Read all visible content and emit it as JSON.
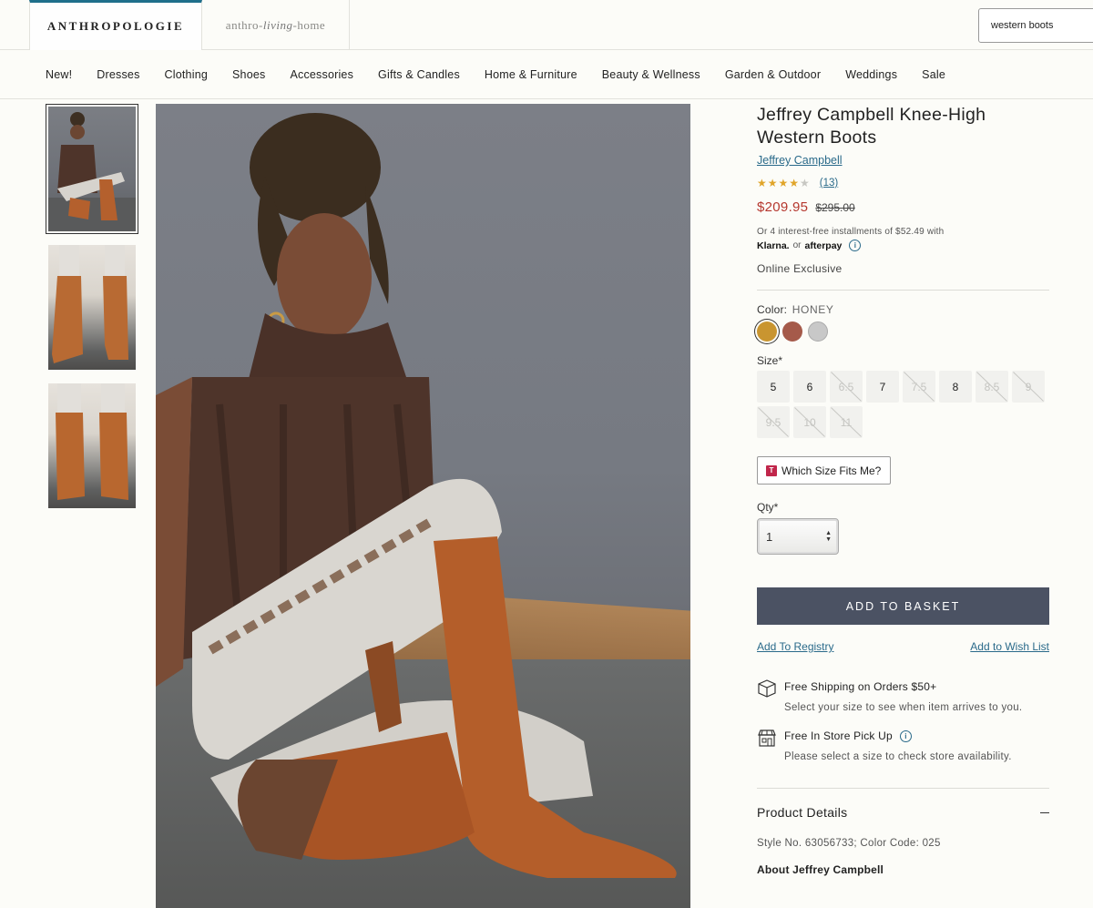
{
  "header": {
    "brand_primary": "ANTHROPOLOGIE",
    "brand_secondary_pre": "anthro",
    "brand_secondary_script": "living",
    "brand_secondary_post": "home",
    "search_value": "western boots"
  },
  "nav": {
    "items": [
      "New!",
      "Dresses",
      "Clothing",
      "Shoes",
      "Accessories",
      "Gifts & Candles",
      "Home & Furniture",
      "Beauty & Wellness",
      "Garden & Outdoor",
      "Weddings",
      "Sale"
    ]
  },
  "product": {
    "title": "Jeffrey Campbell Knee-High Western Boots",
    "brand": "Jeffrey Campbell",
    "rating_stars": 4,
    "review_count": "(13)",
    "price_sale": "$209.95",
    "price_original": "$295.00",
    "installments_text": "Or 4 interest-free installments of $52.49 with",
    "klarna": "Klarna.",
    "or": "or",
    "afterpay": "afterpay",
    "online_exclusive": "Online Exclusive",
    "color_label": "Color:",
    "color_value": "HONEY",
    "swatches": [
      {
        "name": "honey",
        "color": "#c99530"
      },
      {
        "name": "rust",
        "color": "#a55a4a"
      },
      {
        "name": "grey",
        "color": "#c8c8c8"
      }
    ],
    "size_label": "Size*",
    "sizes": [
      {
        "label": "5",
        "available": true
      },
      {
        "label": "6",
        "available": true
      },
      {
        "label": "6.5",
        "available": false
      },
      {
        "label": "7",
        "available": true
      },
      {
        "label": "7.5",
        "available": false
      },
      {
        "label": "8",
        "available": true
      },
      {
        "label": "8.5",
        "available": false
      },
      {
        "label": "9",
        "available": false
      },
      {
        "label": "9.5",
        "available": false
      },
      {
        "label": "10",
        "available": false
      },
      {
        "label": "11",
        "available": false
      }
    ],
    "fit_button": "Which Size Fits Me?",
    "qty_label": "Qty*",
    "qty_value": "1",
    "add_to_basket": "ADD TO BASKET",
    "add_to_registry": "Add To Registry",
    "add_to_wishlist": "Add to Wish List",
    "shipping_title": "Free Shipping on Orders $50+",
    "shipping_sub": "Select your size to see when item arrives to you.",
    "pickup_title": "Free In Store Pick Up",
    "pickup_sub": "Please select a size to check store availability.",
    "details_heading": "Product Details",
    "style_no": "Style No. 63056733; Color Code: 025",
    "about": "About Jeffrey Campbell"
  }
}
